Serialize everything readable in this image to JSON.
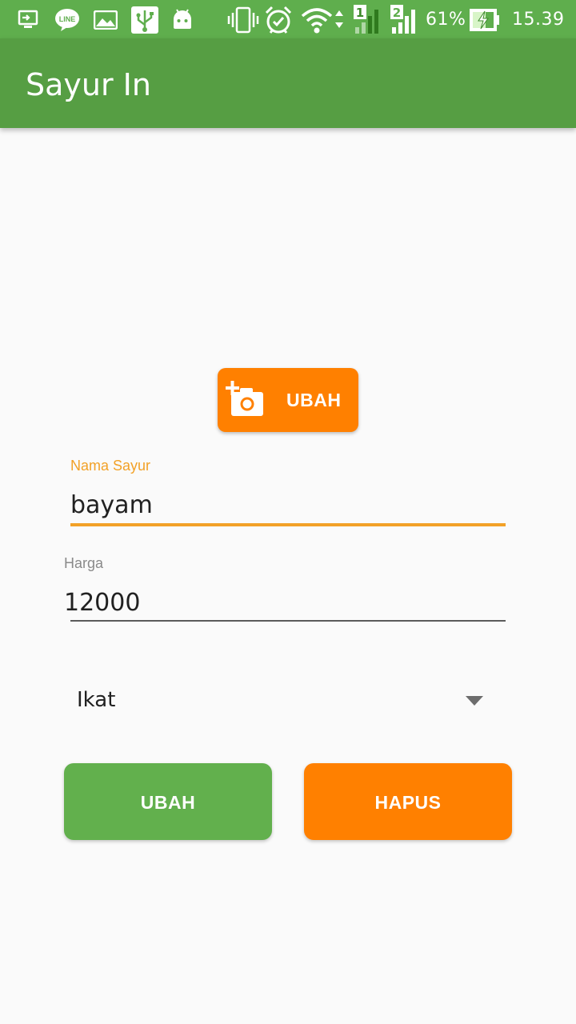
{
  "status_bar": {
    "battery": "61%",
    "time": "15.39",
    "sim_slots": [
      "1",
      "2"
    ],
    "icons": [
      "screen-share-icon",
      "line-app-icon",
      "image-icon",
      "usb-icon",
      "android-debug-icon",
      "vibrate-icon",
      "alarm-icon",
      "wifi-icon",
      "signal-sim1-icon",
      "signal-sim2-icon",
      "battery-charging-icon"
    ],
    "background_color": "#5fae4d"
  },
  "app_bar": {
    "title": "Sayur In",
    "background_color": "#569e43"
  },
  "photo_button": {
    "label": "UBAH",
    "icon": "add-photo-icon",
    "color": "#ff8000"
  },
  "form": {
    "name_field": {
      "label": "Nama Sayur",
      "value": "bayam",
      "focused": true,
      "accent_color": "#f2a127"
    },
    "price_field": {
      "label": "Harga",
      "value": "12000"
    },
    "unit_spinner": {
      "selected": "Ikat"
    }
  },
  "actions": {
    "update_label": "UBAH",
    "update_color": "#62b04d",
    "delete_label": "HAPUS",
    "delete_color": "#ff8000"
  }
}
